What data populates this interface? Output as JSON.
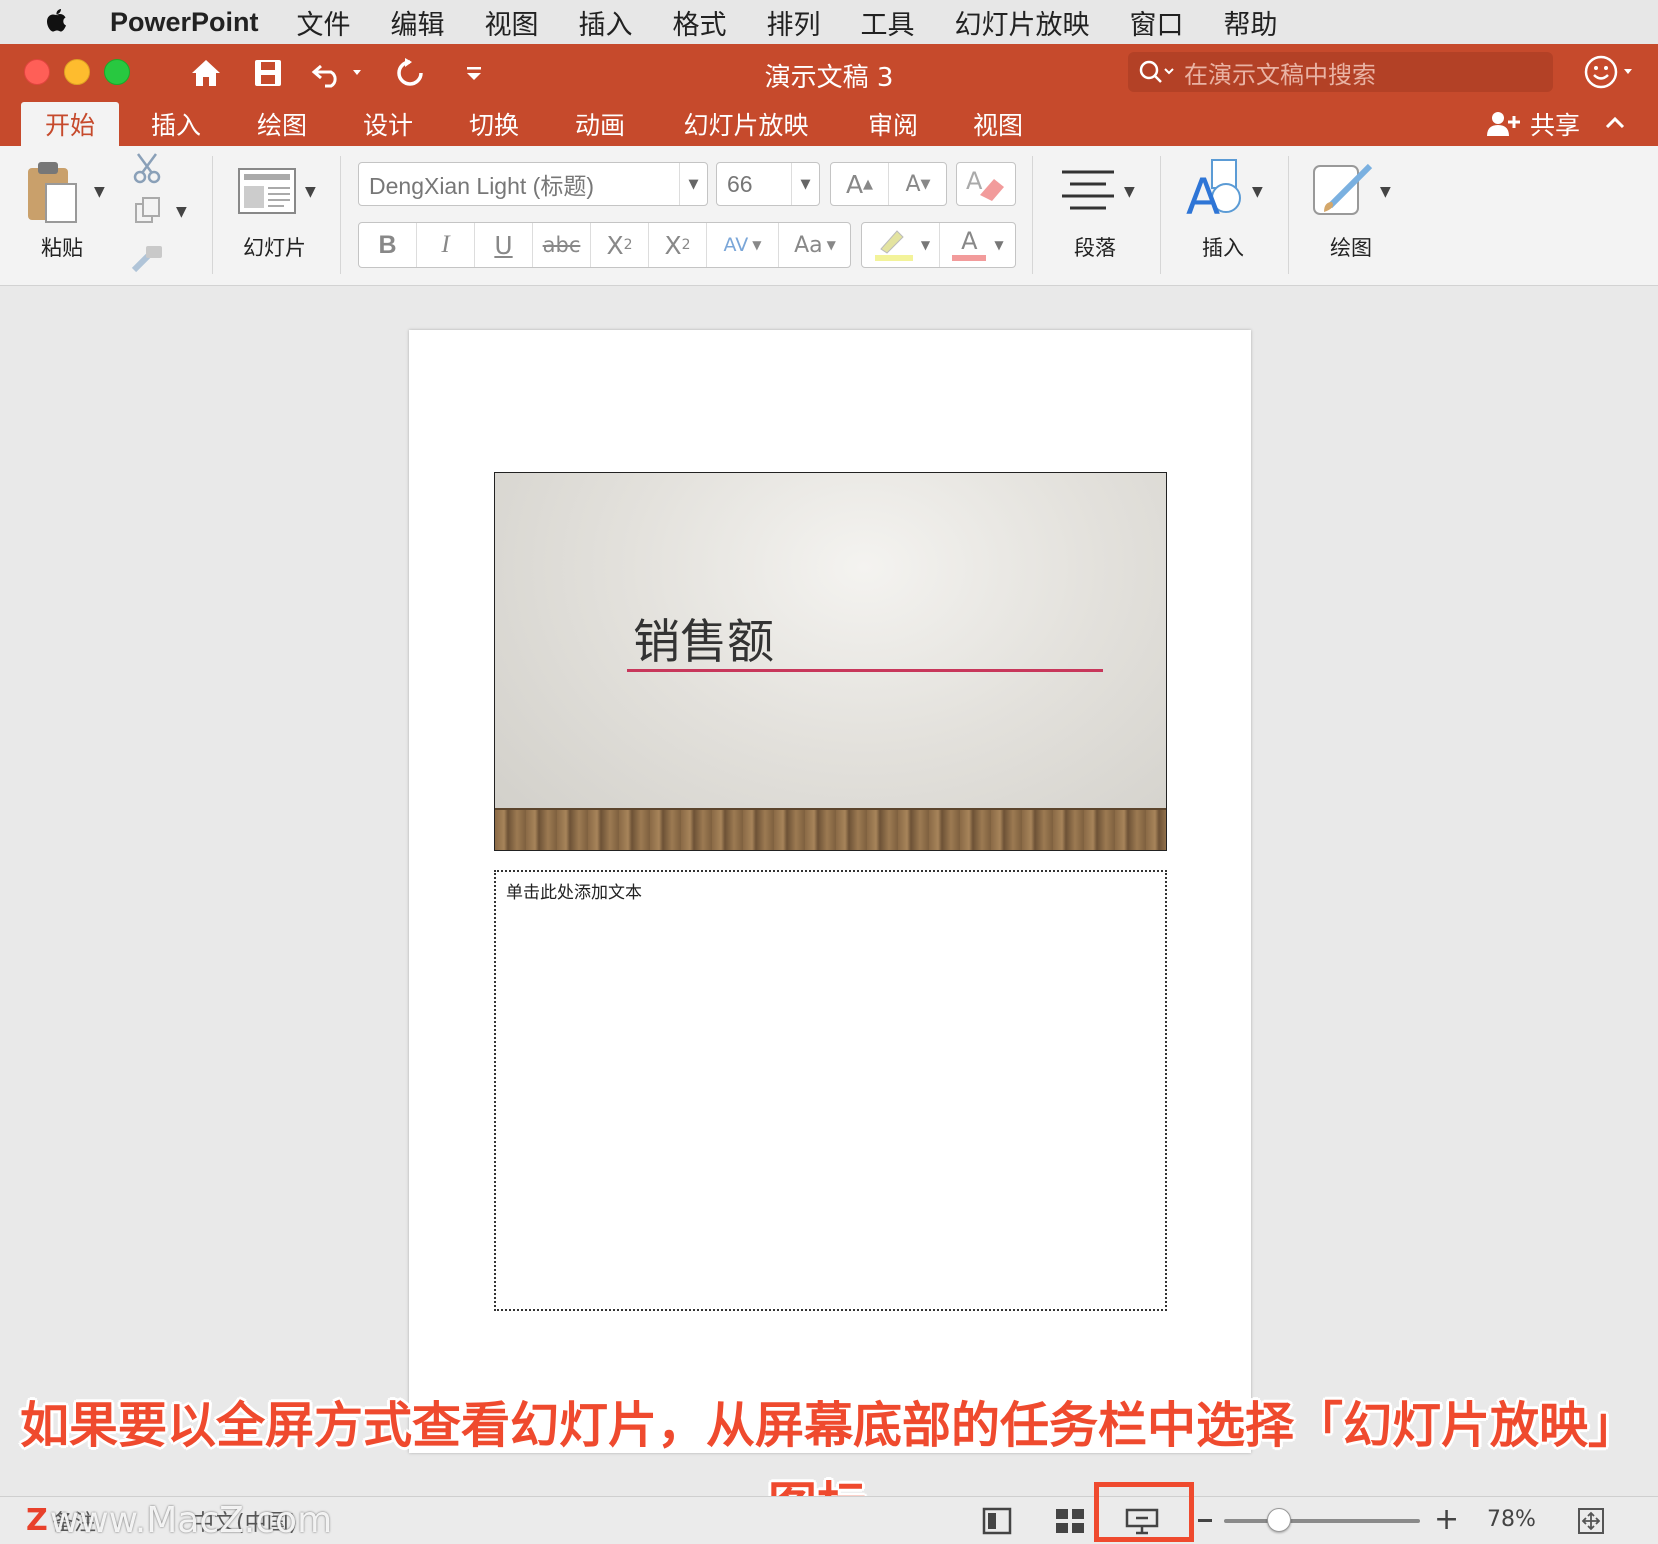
{
  "menubar": {
    "app_name": "PowerPoint",
    "items": [
      "文件",
      "编辑",
      "视图",
      "插入",
      "格式",
      "排列",
      "工具",
      "幻灯片放映",
      "窗口",
      "帮助"
    ]
  },
  "titlebar": {
    "doc_title": "演示文稿 3",
    "search_placeholder": "在演示文稿中搜索"
  },
  "tabs": [
    "开始",
    "插入",
    "绘图",
    "设计",
    "切换",
    "动画",
    "幻灯片放映",
    "审阅",
    "视图"
  ],
  "active_tab": "开始",
  "share_label": "共享",
  "ribbon": {
    "paste_label": "粘贴",
    "slides_label": "幻灯片",
    "font_name": "DengXian Light (标题)",
    "font_size": "66",
    "grow_font": "A",
    "shrink_font": "A",
    "bold": "B",
    "italic": "I",
    "underline": "U",
    "strike": "abc",
    "superscript": "X",
    "superscript_mark": "2",
    "subscript": "X",
    "subscript_mark": "2",
    "spacing": "AV",
    "change_case": "Aa",
    "font_color": "A",
    "paragraph_label": "段落",
    "insert_label": "插入",
    "draw_label": "绘图"
  },
  "slide": {
    "title": "销售额"
  },
  "notes": {
    "placeholder": "单击此处添加文本"
  },
  "caption": {
    "line1": "如果要以全屏方式查看幻灯片，从屏幕底部的任务栏中选择「幻灯片放映」",
    "line2": "图标"
  },
  "statusbar": {
    "notes_label": "备注",
    "language": "中文(中国)",
    "zoom": "78%",
    "zoom_level_percent": 78,
    "watermark": "www.MacZ.com",
    "watermark_logo": "Z"
  },
  "colors": {
    "accent": "#c64a2c",
    "caption_red": "#ef4a2e",
    "slide_line": "#c8375b"
  }
}
